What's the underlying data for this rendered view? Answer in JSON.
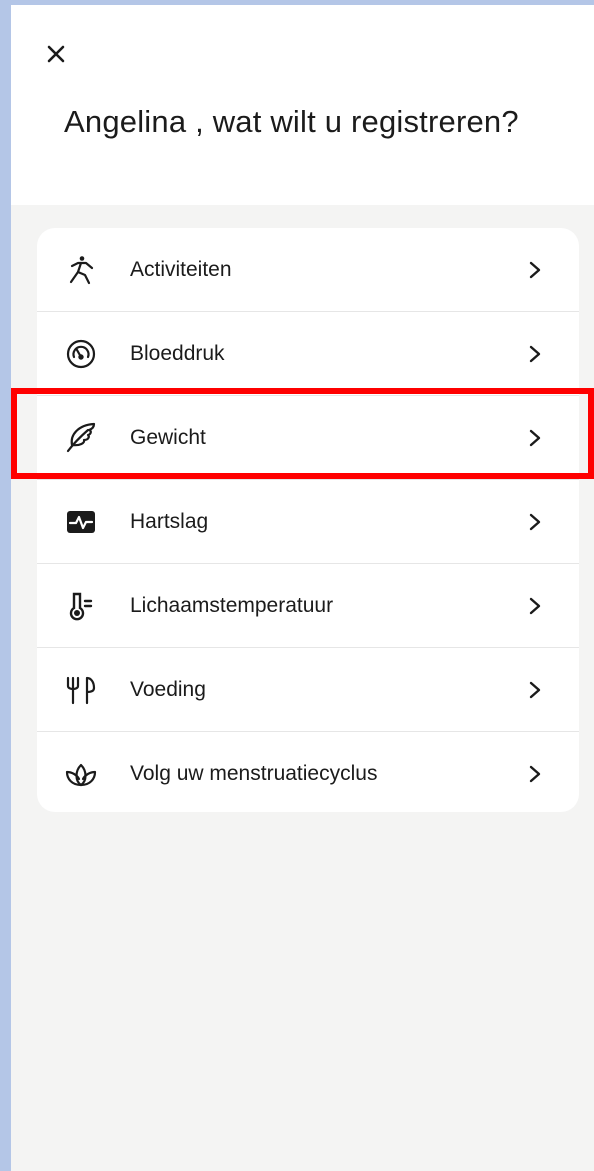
{
  "header": {
    "close_label": "×",
    "title": "Angelina , wat wilt u registreren?"
  },
  "menu": {
    "items": [
      {
        "label": "Activiteiten",
        "icon": "running-person-icon"
      },
      {
        "label": "Bloeddruk",
        "icon": "blood-pressure-gauge-icon"
      },
      {
        "label": "Gewicht",
        "icon": "feather-icon"
      },
      {
        "label": "Hartslag",
        "icon": "heart-rate-icon"
      },
      {
        "label": "Lichaamstemperatuur",
        "icon": "thermometer-icon"
      },
      {
        "label": "Voeding",
        "icon": "cutlery-icon"
      },
      {
        "label": "Volg uw menstruatiecyclus",
        "icon": "lotus-icon"
      }
    ]
  },
  "colors": {
    "page_border": "#b4c6e7",
    "background": "#f4f4f3",
    "card": "#ffffff",
    "text": "#1b1b1b",
    "highlight": "#ff0000"
  }
}
